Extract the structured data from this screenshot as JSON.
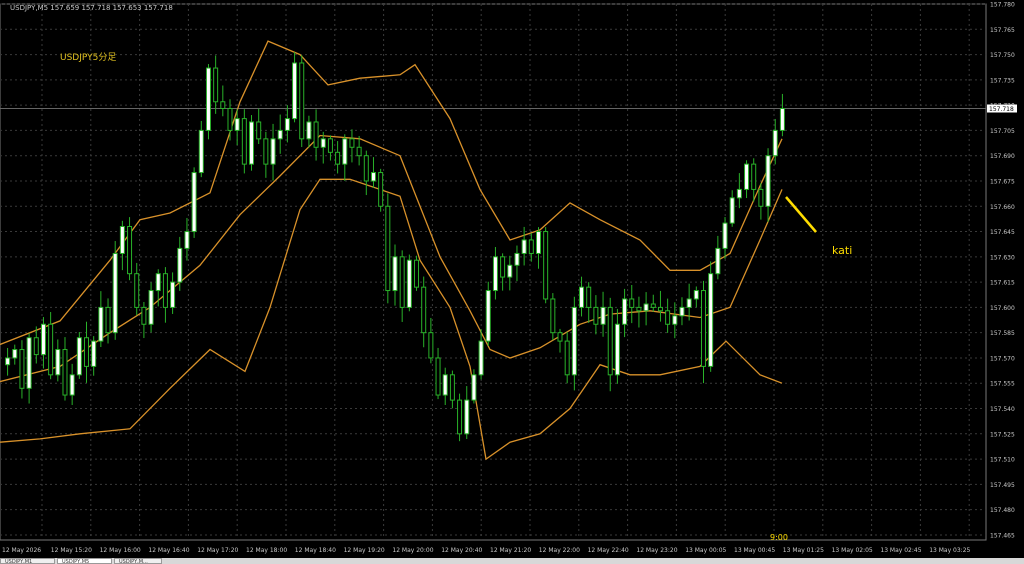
{
  "window": {
    "header": "USDJPY,M5  157.659 157.718 157.653 157.718",
    "indicator_label": "USDJPY5分足",
    "annotation": "kati",
    "time_marker": "9:00",
    "tabs": [
      "USDJPY,M1",
      "USDJPY,M5",
      "USDJPY,M..."
    ]
  },
  "colors": {
    "background": "#000000",
    "grid": "#3a3a3a",
    "candle": "#29b229",
    "candle_up_fill": "#ffffff",
    "band": "#d8912a",
    "annotation": "#ffdd00",
    "axis_text": "#c8c8c8"
  },
  "chart_data": {
    "type": "candlestick",
    "symbol": "USDJPY",
    "timeframe": "M5",
    "current_price": "157.718",
    "ylim": [
      157.462,
      157.78
    ],
    "y_ticks": [
      "157.780",
      "157.765",
      "157.750",
      "157.735",
      "157.720",
      "157.705",
      "157.690",
      "157.675",
      "157.660",
      "157.645",
      "157.630",
      "157.615",
      "157.600",
      "157.585",
      "157.570",
      "157.555",
      "157.540",
      "157.525",
      "157.510",
      "157.495",
      "157.480",
      "157.465"
    ],
    "x_ticks": [
      "12 May 2026",
      "12 May 15:20",
      "12 May 16:00",
      "12 May 16:40",
      "12 May 17:20",
      "12 May 18:00",
      "12 May 18:40",
      "12 May 19:20",
      "12 May 20:00",
      "12 May 20:40",
      "12 May 21:20",
      "12 May 22:00",
      "12 May 22:40",
      "12 May 23:20",
      "13 May 00:05",
      "13 May 00:45",
      "13 May 01:25",
      "13 May 02:05",
      "13 May 02:45",
      "13 May 03:25"
    ],
    "close_path": [
      157.57,
      157.575,
      157.552,
      157.582,
      157.572,
      157.59,
      157.56,
      157.575,
      157.548,
      157.56,
      157.582,
      157.565,
      157.58,
      157.6,
      157.585,
      157.632,
      157.648,
      157.62,
      157.6,
      157.59,
      157.61,
      157.62,
      157.6,
      157.615,
      157.635,
      157.645,
      157.68,
      157.705,
      157.742,
      157.722,
      157.718,
      157.705,
      157.712,
      157.685,
      157.71,
      157.7,
      157.685,
      157.7,
      157.705,
      157.712,
      157.745,
      157.7,
      157.71,
      157.695,
      157.7,
      157.692,
      157.685,
      157.7,
      157.695,
      157.69,
      157.675,
      157.68,
      157.66,
      157.61,
      157.63,
      157.6,
      157.628,
      157.612,
      157.585,
      157.57,
      157.548,
      157.56,
      157.545,
      157.525,
      157.545,
      157.56,
      157.58,
      157.61,
      157.63,
      157.618,
      157.625,
      157.632,
      157.64,
      157.632,
      157.645,
      157.605,
      157.585,
      157.58,
      157.56,
      157.6,
      157.612,
      157.6,
      157.59,
      157.6,
      157.56,
      157.59,
      157.605,
      157.6,
      157.598,
      157.602,
      157.6,
      157.598,
      157.59,
      157.595,
      157.6,
      157.605,
      157.61,
      157.565,
      157.62,
      157.635,
      157.65,
      157.665,
      157.67,
      157.685,
      157.67,
      157.66,
      157.69,
      157.705,
      157.718
    ],
    "bands": {
      "upper": [
        [
          0,
          157.578
        ],
        [
          60,
          157.592
        ],
        [
          110,
          157.628
        ],
        [
          140,
          157.652
        ],
        [
          170,
          157.656
        ],
        [
          210,
          157.668
        ],
        [
          240,
          157.722
        ],
        [
          268,
          157.758
        ],
        [
          300,
          157.75
        ],
        [
          328,
          157.732
        ],
        [
          360,
          157.736
        ],
        [
          400,
          157.738
        ],
        [
          415,
          157.744
        ],
        [
          450,
          157.712
        ],
        [
          480,
          157.67
        ],
        [
          510,
          157.64
        ],
        [
          540,
          157.646
        ],
        [
          570,
          157.662
        ],
        [
          600,
          157.652
        ],
        [
          640,
          157.64
        ],
        [
          670,
          157.622
        ],
        [
          700,
          157.622
        ],
        [
          730,
          157.632
        ],
        [
          760,
          157.672
        ],
        [
          782,
          157.7
        ]
      ],
      "middle": [
        [
          0,
          157.556
        ],
        [
          60,
          157.565
        ],
        [
          110,
          157.585
        ],
        [
          150,
          157.6
        ],
        [
          200,
          157.625
        ],
        [
          240,
          157.655
        ],
        [
          280,
          157.678
        ],
        [
          320,
          157.702
        ],
        [
          360,
          157.7
        ],
        [
          400,
          157.69
        ],
        [
          440,
          157.63
        ],
        [
          470,
          157.598
        ],
        [
          490,
          157.575
        ],
        [
          510,
          157.57
        ],
        [
          540,
          157.576
        ],
        [
          580,
          157.59
        ],
        [
          610,
          157.596
        ],
        [
          650,
          157.598
        ],
        [
          700,
          157.594
        ],
        [
          730,
          157.6
        ],
        [
          760,
          157.64
        ],
        [
          782,
          157.67
        ]
      ],
      "lower": [
        [
          0,
          157.52
        ],
        [
          40,
          157.522
        ],
        [
          80,
          157.525
        ],
        [
          130,
          157.528
        ],
        [
          170,
          157.552
        ],
        [
          210,
          157.575
        ],
        [
          245,
          157.562
        ],
        [
          270,
          157.6
        ],
        [
          300,
          157.658
        ],
        [
          320,
          157.676
        ],
        [
          350,
          157.676
        ],
        [
          400,
          157.666
        ],
        [
          420,
          157.628
        ],
        [
          450,
          157.6
        ],
        [
          470,
          157.565
        ],
        [
          486,
          157.51
        ],
        [
          510,
          157.52
        ],
        [
          540,
          157.525
        ],
        [
          570,
          157.54
        ],
        [
          600,
          157.566
        ],
        [
          630,
          157.56
        ],
        [
          660,
          157.56
        ],
        [
          700,
          157.565
        ],
        [
          726,
          157.58
        ],
        [
          760,
          157.56
        ],
        [
          782,
          157.555
        ]
      ]
    }
  }
}
